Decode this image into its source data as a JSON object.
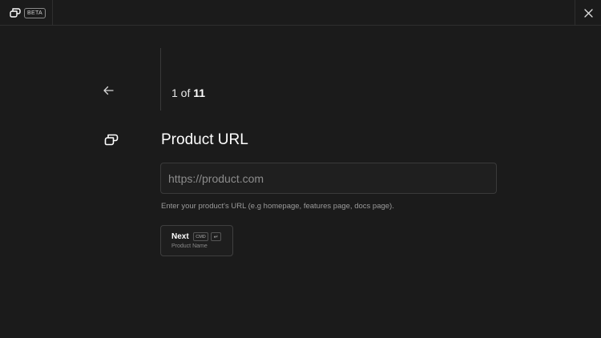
{
  "header": {
    "badge": "BETA",
    "close_icon": "close-icon",
    "logo_icon": "brand-logo-icon"
  },
  "nav": {
    "back_icon": "arrow-left-icon"
  },
  "progress": {
    "prefix": "1 of",
    "total": "11"
  },
  "question": {
    "icon": "brand-logo-icon",
    "title": "Product URL",
    "input_placeholder": "https://product.com",
    "input_value": "",
    "helper": "Enter your product's URL (e.g homepage, features page, docs page)."
  },
  "next_button": {
    "label": "Next",
    "shortcut_modifier": "CMD",
    "shortcut_key": "↵",
    "sublabel": "Product Name"
  },
  "colors": {
    "background": "#1b1b1b",
    "border": "#2f2f2f",
    "text": "#ffffff",
    "muted": "#9a9a9a"
  }
}
